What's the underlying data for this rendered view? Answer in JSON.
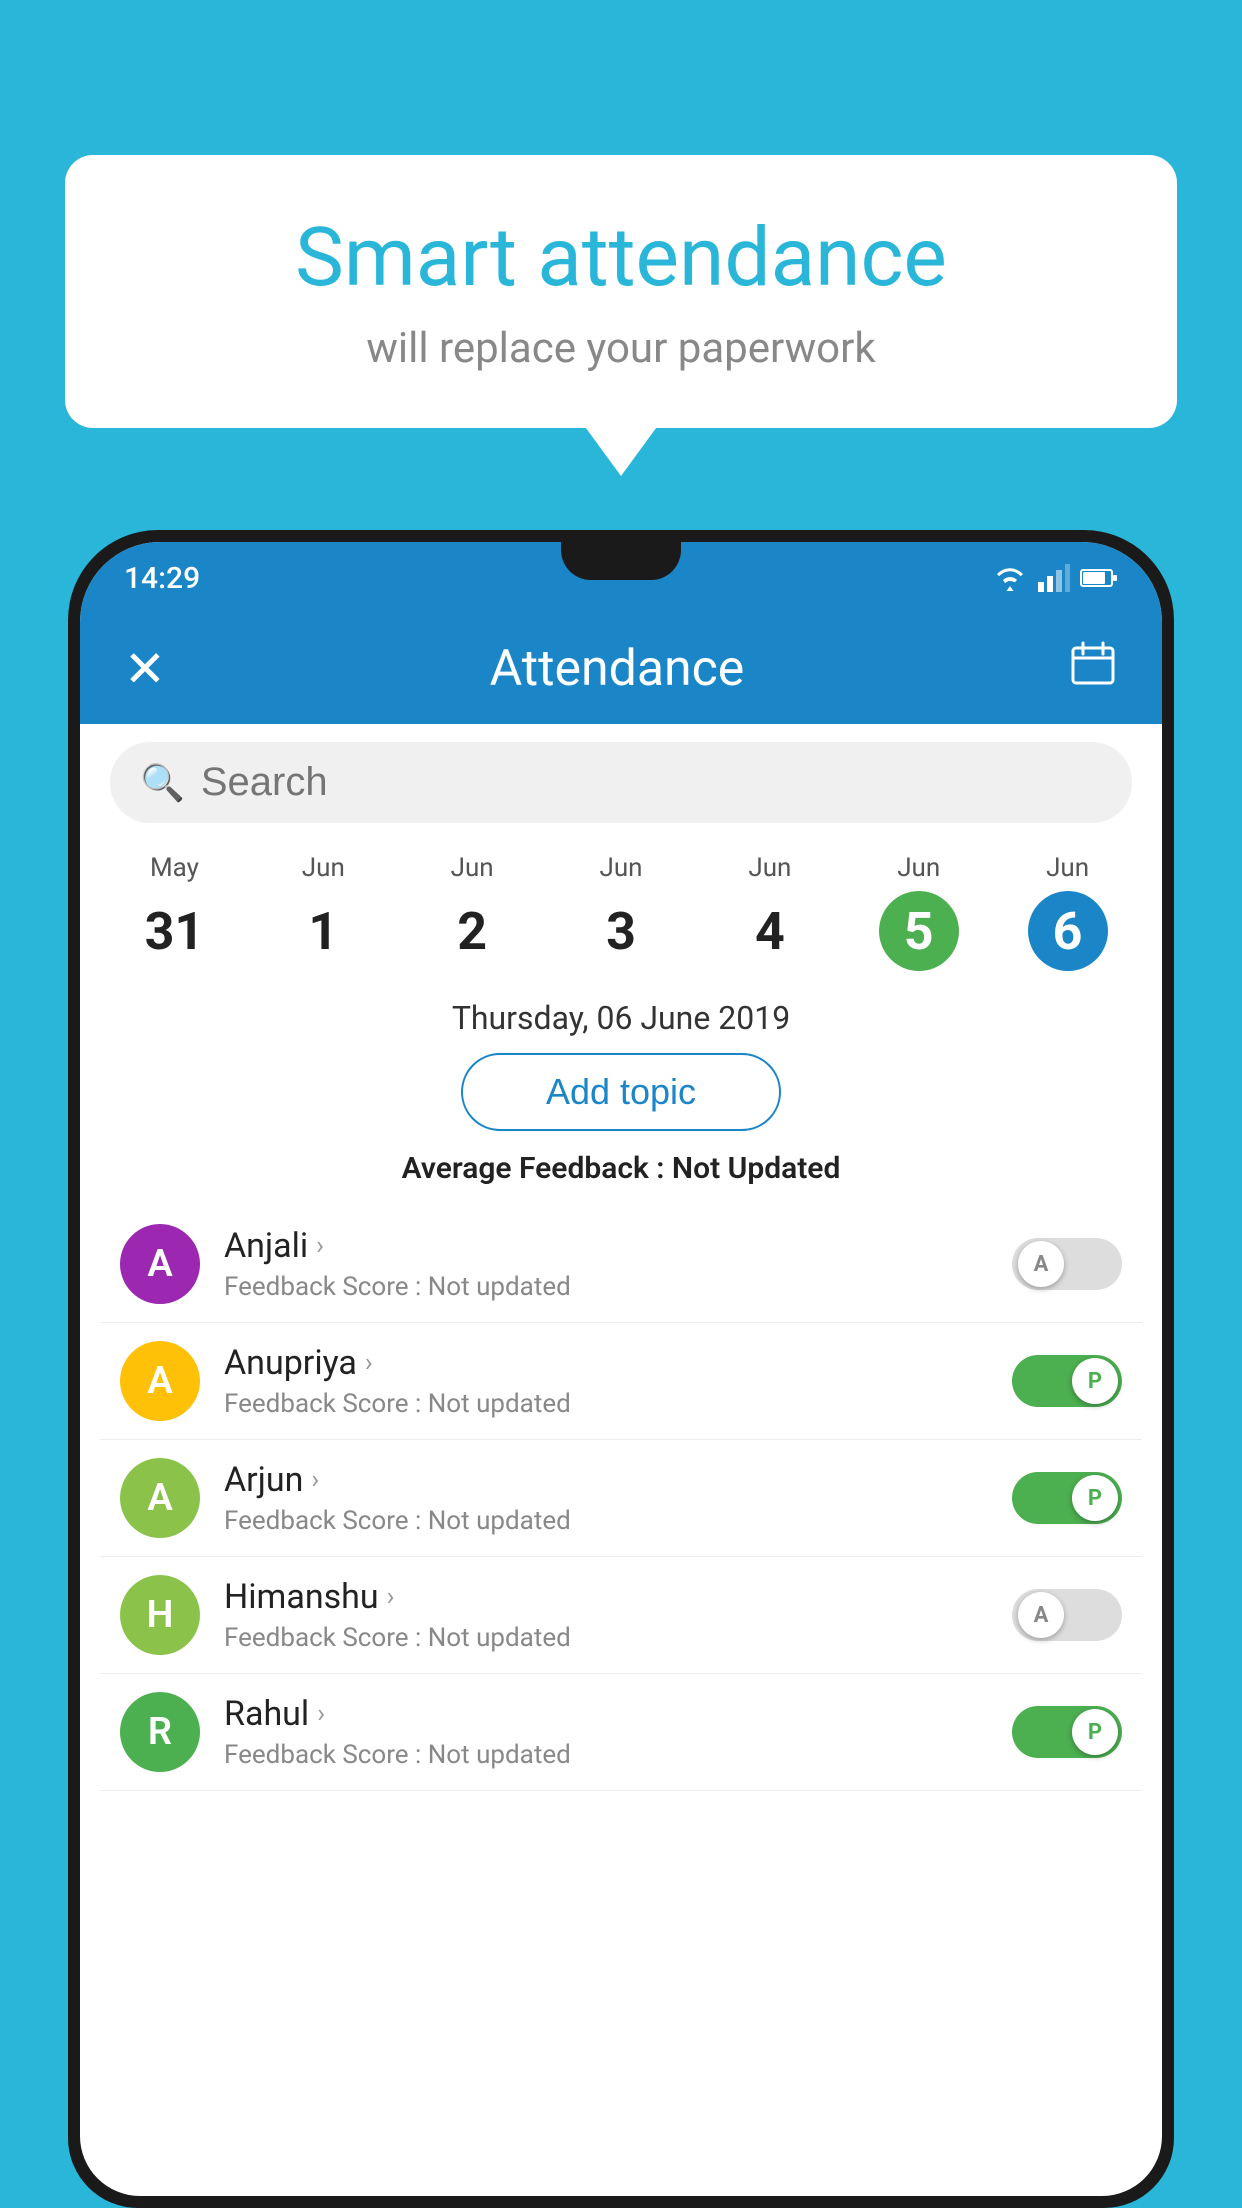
{
  "app": {
    "background_color": "#29b6d8"
  },
  "bubble": {
    "title": "Smart attendance",
    "subtitle": "will replace your paperwork"
  },
  "status_bar": {
    "time": "14:29",
    "wifi_icon": "wifi",
    "signal_icon": "signal",
    "battery_icon": "battery"
  },
  "app_bar": {
    "close_label": "✕",
    "title": "Attendance",
    "calendar_icon": "calendar"
  },
  "search": {
    "placeholder": "Search"
  },
  "dates": [
    {
      "month": "May",
      "day": "31",
      "state": "normal"
    },
    {
      "month": "Jun",
      "day": "1",
      "state": "normal"
    },
    {
      "month": "Jun",
      "day": "2",
      "state": "normal"
    },
    {
      "month": "Jun",
      "day": "3",
      "state": "normal"
    },
    {
      "month": "Jun",
      "day": "4",
      "state": "normal"
    },
    {
      "month": "Jun",
      "day": "5",
      "state": "today"
    },
    {
      "month": "Jun",
      "day": "6",
      "state": "selected"
    }
  ],
  "selected_date_label": "Thursday, 06 June 2019",
  "add_topic_button": "Add topic",
  "avg_feedback": {
    "label": "Average Feedback : ",
    "value": "Not Updated"
  },
  "students": [
    {
      "name": "Anjali",
      "avatar_letter": "A",
      "avatar_color": "#9c27b0",
      "feedback": "Feedback Score : Not updated",
      "attendance": "absent",
      "toggle_label": "A"
    },
    {
      "name": "Anupriya",
      "avatar_letter": "A",
      "avatar_color": "#ffc107",
      "feedback": "Feedback Score : Not updated",
      "attendance": "present",
      "toggle_label": "P"
    },
    {
      "name": "Arjun",
      "avatar_letter": "A",
      "avatar_color": "#8bc34a",
      "feedback": "Feedback Score : Not updated",
      "attendance": "present",
      "toggle_label": "P"
    },
    {
      "name": "Himanshu",
      "avatar_letter": "H",
      "avatar_color": "#8bc34a",
      "feedback": "Feedback Score : Not updated",
      "attendance": "absent",
      "toggle_label": "A"
    },
    {
      "name": "Rahul",
      "avatar_letter": "R",
      "avatar_color": "#4caf50",
      "feedback": "Feedback Score : Not updated",
      "attendance": "present",
      "toggle_label": "P"
    }
  ]
}
